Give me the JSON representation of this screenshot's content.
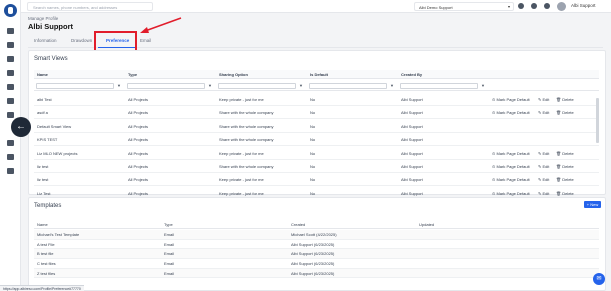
{
  "topbar": {
    "search_placeholder": "Search names, phone numbers, and addresses",
    "company": "Albi Demo Support",
    "user": "Albi Support"
  },
  "page": {
    "breadcrumb": "Manage Profile",
    "title": "Albi Support"
  },
  "tabs": [
    "Information",
    "Drawdown",
    "Preference",
    "Email"
  ],
  "smart_views": {
    "title": "Smart Views",
    "columns": [
      "Name",
      "Type",
      "Sharing Option",
      "Is Default",
      "Created By"
    ],
    "rows": [
      {
        "name": "albi Test",
        "type": "All Projects",
        "sharing": "Keep private - just for me",
        "default": "No",
        "created": "Albi Support",
        "mark": "Mark Page Default",
        "edit": "Edit",
        "delete": "Delete"
      },
      {
        "name": "asdf a",
        "type": "All Projects",
        "sharing": "Share with the whole company",
        "default": "No",
        "created": "Albi Support",
        "mark": "Mark Page Default",
        "edit": "Edit",
        "delete": "Delete"
      },
      {
        "name": "Default Smart View",
        "type": "All Projects",
        "sharing": "Share with the whole company",
        "default": "No",
        "created": "Albi Support",
        "mark": "",
        "edit": "",
        "delete": ""
      },
      {
        "name": "KPIS TEST",
        "type": "All Projects",
        "sharing": "Share with the whole company",
        "default": "No",
        "created": "Albi Support",
        "mark": "",
        "edit": "",
        "delete": ""
      },
      {
        "name": "Liz MLO NEW projects",
        "type": "All Projects",
        "sharing": "Keep private - just for me",
        "default": "No",
        "created": "Albi Support",
        "mark": "Mark Page Default",
        "edit": "Edit",
        "delete": "Delete"
      },
      {
        "name": "liz test",
        "type": "All Projects",
        "sharing": "Share with the whole company",
        "default": "No",
        "created": "Albi Support",
        "mark": "Mark Page Default",
        "edit": "Edit",
        "delete": "Delete"
      },
      {
        "name": "liz test",
        "type": "All Projects",
        "sharing": "Keep private - just for me",
        "default": "No",
        "created": "Albi Support",
        "mark": "Mark Page Default",
        "edit": "Edit",
        "delete": "Delete"
      },
      {
        "name": "Liz Test",
        "type": "All Projects",
        "sharing": "Keep private - just for me",
        "default": "No",
        "created": "Albi Support",
        "mark": "Mark Page Default",
        "edit": "Edit",
        "delete": "Delete"
      }
    ]
  },
  "templates": {
    "title": "Templates",
    "new_label": "+ New",
    "columns": [
      "Name",
      "Type",
      "Created",
      "Updated"
    ],
    "rows": [
      {
        "name": "Michael's Test Template",
        "type": "Email",
        "created": "Michael Scott (4/22/2025)",
        "updated": ""
      },
      {
        "name": "A test File",
        "type": "Email",
        "created": "Albi Support (6/23/2025)",
        "updated": ""
      },
      {
        "name": "B test file",
        "type": "Email",
        "created": "Albi Support (6/23/2025)",
        "updated": ""
      },
      {
        "name": "C test files",
        "type": "Email",
        "created": "Albi Support (6/23/2025)",
        "updated": ""
      },
      {
        "name": "Z test files",
        "type": "Email",
        "created": "Albi Support (6/23/2025)",
        "updated": ""
      }
    ]
  },
  "status_url": "https://app.albireso.com/Profile/Preference#77770"
}
